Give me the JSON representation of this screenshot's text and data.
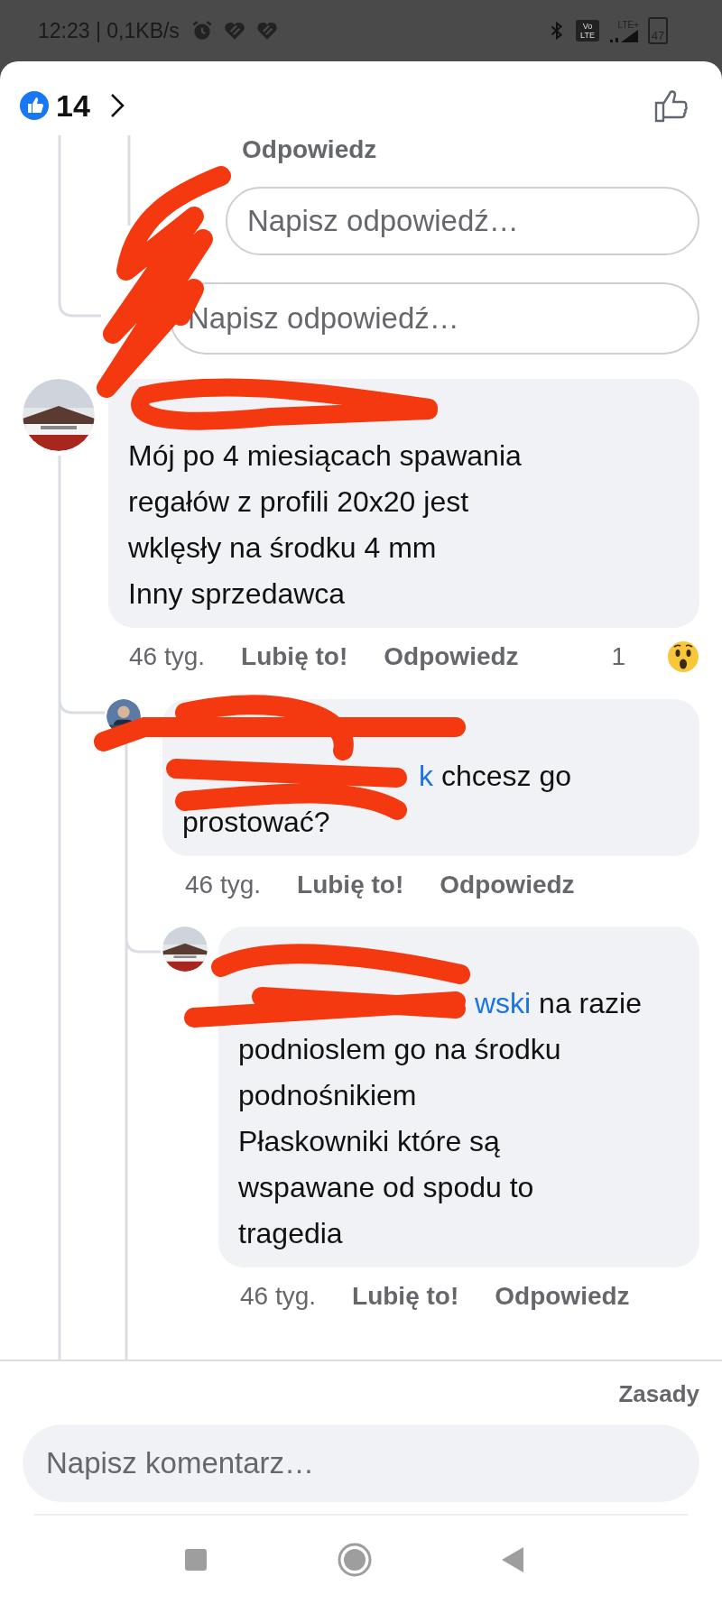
{
  "status_bar": {
    "time": "12:23 | 0,1KB/s",
    "volte": "Vo LTE",
    "network": "LTE+",
    "battery": "47"
  },
  "header": {
    "reaction_count": "14"
  },
  "scrolled_text": "Odpowiedz",
  "reply_fields": [
    {
      "placeholder": "Napisz odpowiedź…"
    },
    {
      "placeholder": "Napisz odpowiedź…"
    }
  ],
  "comments": [
    {
      "text": "Mój po 4 miesiącach spawania\nregałów z profili 20x20 jest\nwklęsły na środku 4 mm\nInny sprzedawca",
      "time": "46 tyg.",
      "like": "Lubię to!",
      "reply": "Odpowiedz",
      "reactions": {
        "count": "1",
        "kind": "wow"
      },
      "children": [
        {
          "mention": "k",
          "text": "chcesz go\nprostować?",
          "time": "46 tyg.",
          "like": "Lubię to!",
          "reply": "Odpowiedz",
          "children": [
            {
              "mention": "wski",
              "text": "na razie\npodnioslem go na środku\npodnośnikiem\nPłaskowniki które są\nwspawane od spodu to\ntragedia",
              "time": "46 tyg.",
              "like": "Lubię to!",
              "reply": "Odpowiedz"
            }
          ]
        }
      ]
    }
  ],
  "footer": {
    "rules_link": "Zasady",
    "comment_field": {
      "placeholder": "Napisz komentarz…"
    }
  }
}
